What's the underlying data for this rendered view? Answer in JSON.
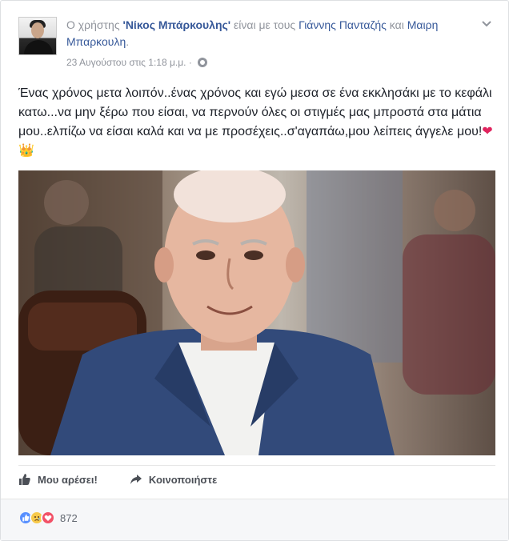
{
  "header": {
    "prefix": "Ο χρήστης",
    "author": "'Νίκος Μπάρκουλης'",
    "with_text": "είναι με τους",
    "tagged1": "Γιάννης Πανταζής",
    "and_text": "και",
    "tagged2": "Μαιρη Μπαρκουλη",
    "period": ".",
    "timestamp": "23 Αυγούστου στις 1:18 μ.μ. ·"
  },
  "post": {
    "text": "Ένας χρόνος μετα λοιπόν..ένας χρόνος και εγώ μεσα σε ένα εκκλησάκι με το κεφάλι κατω...να μην ξέρω που είσαι, να περνούν όλες οι στιγμές μας μπροστά στα μάτια μου..ελπίζω να είσαι καλά και να με προσέχεις..σ'αγαπάω,μου λείπεις άγγελε μου!",
    "heart": "❤",
    "crown": "👑"
  },
  "actions": {
    "like_label": "Μου αρέσει!",
    "share_label": "Κοινοποιήστε"
  },
  "reactions": {
    "count": "872",
    "types": [
      "like-icon",
      "sad-icon",
      "love-icon"
    ]
  }
}
